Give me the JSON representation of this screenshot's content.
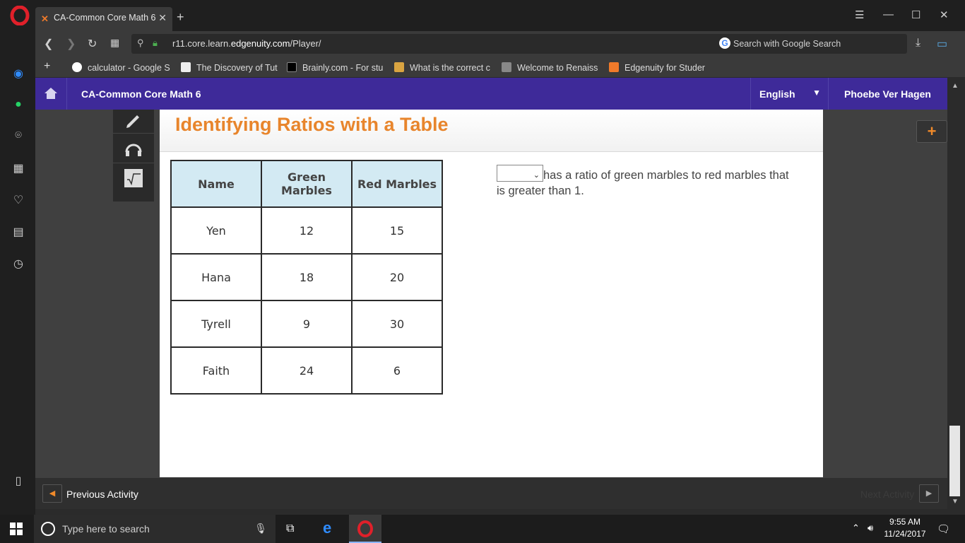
{
  "browser": {
    "tab_title": "CA-Common Core Math 6",
    "url_prefix": "r11.core.learn.",
    "url_host": "edgenuity.com",
    "url_path": "/Player/",
    "search_placeholder": "Search with Google Search",
    "bookmarks": [
      {
        "label": "calculator - Google S",
        "icon": "google-icon"
      },
      {
        "label": "The Discovery of Tut",
        "icon": "document-icon"
      },
      {
        "label": "Brainly.com - For stu",
        "icon": "brainly-icon"
      },
      {
        "label": "What is the correct c",
        "icon": "question-icon"
      },
      {
        "label": "Welcome to Renaiss",
        "icon": "renaissance-icon"
      },
      {
        "label": "Edgenuity for Studer",
        "icon": "edgenuity-icon"
      }
    ]
  },
  "course": {
    "title": "CA-Common Core Math 6",
    "language": "English",
    "user": "Phoebe Ver Hagen"
  },
  "activity": {
    "title": "Identifying Ratios with a Table",
    "table": {
      "headers": [
        "Name",
        "Green Marbles",
        "Red Marbles"
      ],
      "rows": [
        [
          "Yen",
          "12",
          "15"
        ],
        [
          "Hana",
          "18",
          "20"
        ],
        [
          "Tyrell",
          "9",
          "30"
        ],
        [
          "Faith",
          "24",
          "6"
        ]
      ]
    },
    "question_text": "has a ratio of green marbles to red marbles that is greater than 1.",
    "select_value": ""
  },
  "footer": {
    "previous_label": "Previous Activity",
    "next_label": "Next Activity"
  },
  "taskbar": {
    "search_placeholder": "Type here to search",
    "time": "9:55 AM",
    "date": "11/24/2017"
  },
  "colors": {
    "course_header": "#3e2a99",
    "title_orange": "#e8852c",
    "table_header_bg": "#d3eaf3"
  }
}
